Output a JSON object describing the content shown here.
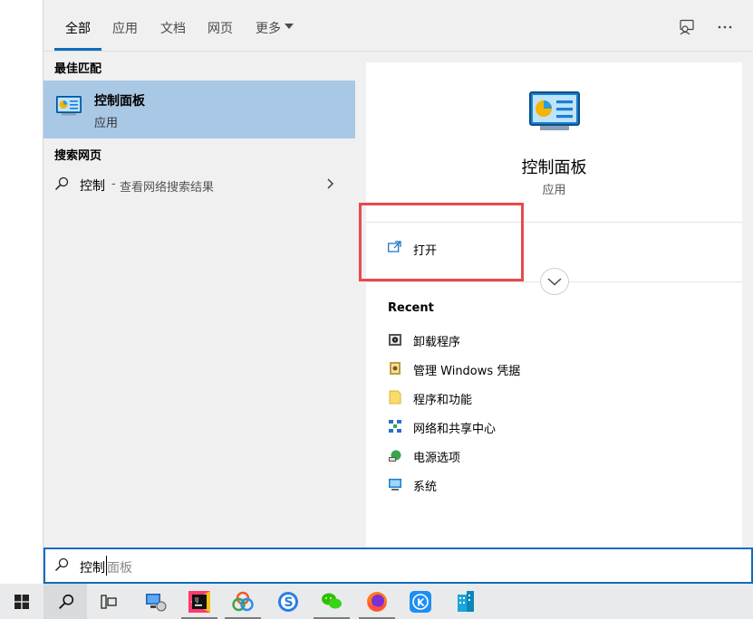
{
  "tabs": {
    "all": "全部",
    "apps": "应用",
    "documents": "文档",
    "web": "网页",
    "more": "更多"
  },
  "sections": {
    "best_match": "最佳匹配",
    "search_web": "搜索网页"
  },
  "best_match": {
    "title": "控制面板",
    "subtitle": "应用",
    "icon": "control-panel-icon"
  },
  "web_result": {
    "query": "控制",
    "separator": "-",
    "hint": "查看网络搜索结果"
  },
  "preview": {
    "title": "控制面板",
    "subtitle": "应用",
    "open_label": "打开",
    "recent_heading": "Recent",
    "recent_items": [
      {
        "label": "卸载程序",
        "icon": "uninstall-program-icon"
      },
      {
        "label": "管理 Windows 凭据",
        "icon": "credential-manager-icon"
      },
      {
        "label": "程序和功能",
        "icon": "programs-features-icon"
      },
      {
        "label": "网络和共享中心",
        "icon": "network-sharing-icon"
      },
      {
        "label": "电源选项",
        "icon": "power-options-icon"
      },
      {
        "label": "系统",
        "icon": "system-icon"
      }
    ]
  },
  "search": {
    "typed": "控制",
    "suggestion": "面板"
  },
  "taskbar": {
    "items": [
      "start-icon",
      "search-icon",
      "task-view-icon",
      "remote-desktop-icon",
      "jetbrains-icon",
      "browser-swirl-icon",
      "sogou-icon",
      "wechat-icon",
      "firefox-icon",
      "kugou-icon",
      "building-app-icon"
    ]
  },
  "colors": {
    "accent": "#0f6cbd",
    "selection": "#a9c8e6",
    "highlight_box": "#e84a4a"
  }
}
